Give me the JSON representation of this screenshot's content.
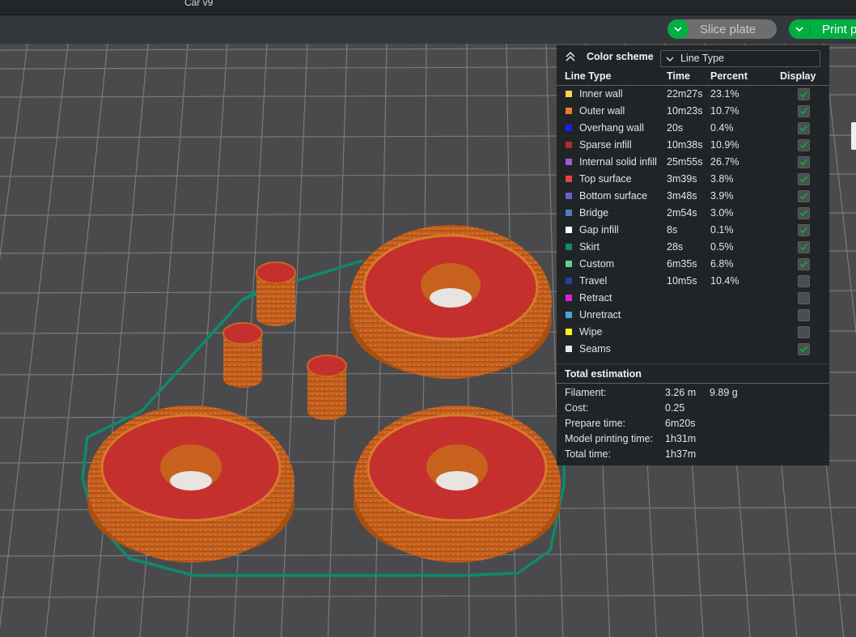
{
  "window": {
    "title": "Car v9"
  },
  "toolbar": {
    "slice_label": "Slice plate",
    "print_label": "Print p"
  },
  "colors": {
    "accent": "#00ae42",
    "plate": "#4a4a4c",
    "gridline": "#7a7a7c",
    "model_wall": "#c8611d",
    "model_top": "#c52b2b",
    "skirt": "#0e8a6a"
  },
  "panel": {
    "color_scheme_label": "Color scheme",
    "color_scheme_value": "Line Type",
    "columns": {
      "line_type": "Line Type",
      "time": "Time",
      "percent": "Percent",
      "display": "Display"
    },
    "rows": [
      {
        "name": "Inner wall",
        "color": "#f7d94c",
        "time": "22m27s",
        "percent": "23.1%",
        "display": true
      },
      {
        "name": "Outer wall",
        "color": "#f07b2e",
        "time": "10m23s",
        "percent": "10.7%",
        "display": true
      },
      {
        "name": "Overhang wall",
        "color": "#1e1ef0",
        "time": "20s",
        "percent": "0.4%",
        "display": true
      },
      {
        "name": "Sparse infill",
        "color": "#b32d2d",
        "time": "10m38s",
        "percent": "10.9%",
        "display": true
      },
      {
        "name": "Internal solid infill",
        "color": "#a45ad6",
        "time": "25m55s",
        "percent": "26.7%",
        "display": true
      },
      {
        "name": "Top surface",
        "color": "#e94242",
        "time": "3m39s",
        "percent": "3.8%",
        "display": true
      },
      {
        "name": "Bottom surface",
        "color": "#6b5fcf",
        "time": "3m48s",
        "percent": "3.9%",
        "display": true
      },
      {
        "name": "Bridge",
        "color": "#4c7fc6",
        "time": "2m54s",
        "percent": "3.0%",
        "display": true
      },
      {
        "name": "Gap infill",
        "color": "#ffffff",
        "time": "8s",
        "percent": "0.1%",
        "display": true
      },
      {
        "name": "Skirt",
        "color": "#0f8a6a",
        "time": "28s",
        "percent": "0.5%",
        "display": true
      },
      {
        "name": "Custom",
        "color": "#5ed191",
        "time": "6m35s",
        "percent": "6.8%",
        "display": true
      },
      {
        "name": "Travel",
        "color": "#2d3d9e",
        "time": "10m5s",
        "percent": "10.4%",
        "display": false
      },
      {
        "name": "Retract",
        "color": "#e020d8",
        "time": "",
        "percent": "",
        "display": false
      },
      {
        "name": "Unretract",
        "color": "#45a9d8",
        "time": "",
        "percent": "",
        "display": false
      },
      {
        "name": "Wipe",
        "color": "#f4f41c",
        "time": "",
        "percent": "",
        "display": false
      },
      {
        "name": "Seams",
        "color": "#e8e8e8",
        "time": "",
        "percent": "",
        "display": true
      }
    ],
    "total": {
      "title": "Total estimation",
      "filament_label": "Filament:",
      "filament_length": "3.26 m",
      "filament_weight": "9.89 g",
      "cost_label": "Cost:",
      "cost": "0.25",
      "prepare_label": "Prepare time:",
      "prepare": "6m20s",
      "model_label": "Model printing time:",
      "model": "1h31m",
      "total_label": "Total time:",
      "total": "1h37m"
    }
  }
}
